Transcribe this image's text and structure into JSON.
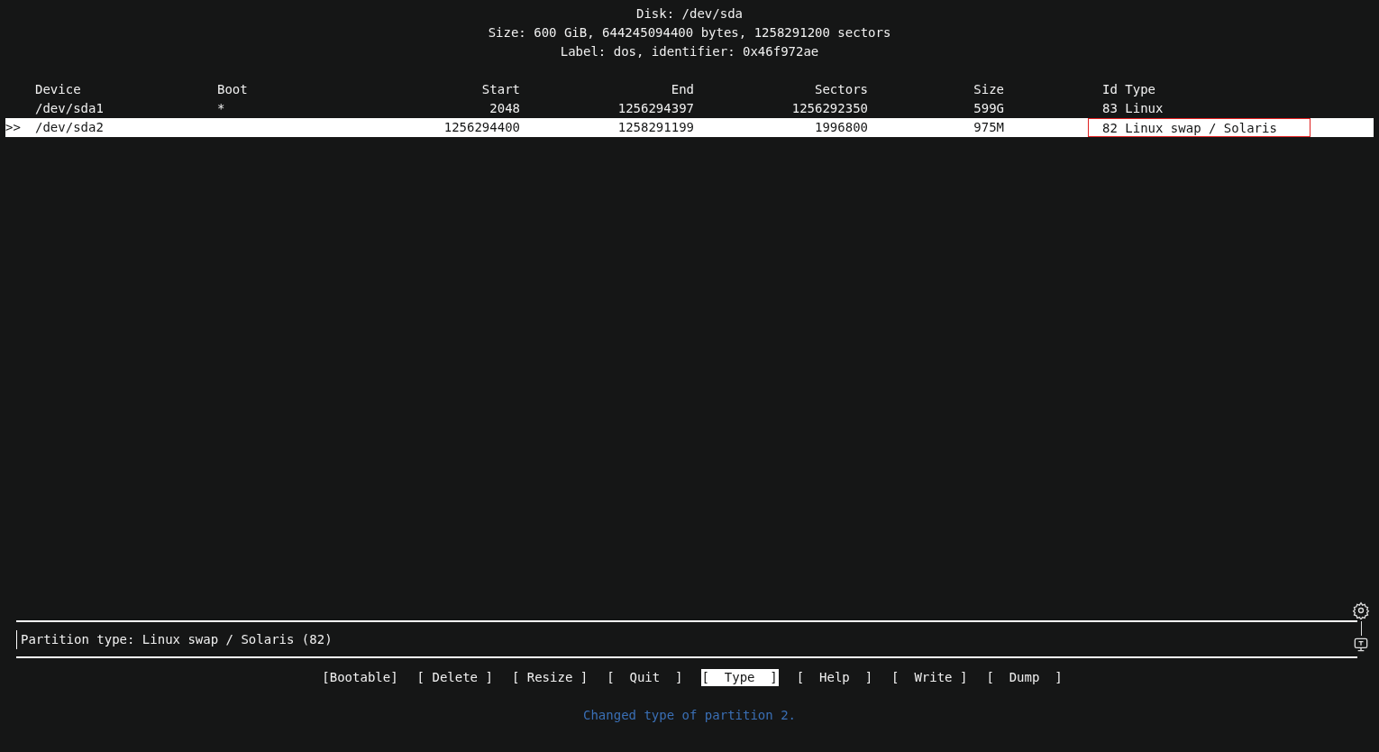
{
  "header": {
    "disk": "Disk: /dev/sda",
    "size": "Size: 600 GiB, 644245094400 bytes, 1258291200 sectors",
    "label": "Label: dos, identifier: 0x46f972ae"
  },
  "table": {
    "cursor": ">>",
    "columns": [
      "Device",
      "Boot",
      "Start",
      "End",
      "Sectors",
      "Size",
      "Id Type"
    ],
    "rows": [
      {
        "selected": false,
        "type_outlined": false,
        "cells": [
          "/dev/sda1",
          "*",
          "2048",
          "1256294397",
          "1256292350",
          "599G",
          "83 Linux"
        ]
      },
      {
        "selected": true,
        "type_outlined": true,
        "cells": [
          "/dev/sda2",
          "",
          "1256294400",
          "1258291199",
          "1996800",
          "975M",
          "82 Linux swap / Solaris"
        ]
      }
    ]
  },
  "info_box": {
    "text": "Partition type: Linux swap / Solaris (82)"
  },
  "actions": [
    {
      "label": "[Bootable]",
      "selected": false
    },
    {
      "label": "[ Delete ]",
      "selected": false
    },
    {
      "label": "[ Resize ]",
      "selected": false
    },
    {
      "label": "[  Quit  ]",
      "selected": false
    },
    {
      "label": "[  Type  ]",
      "selected": true
    },
    {
      "label": "[  Help  ]",
      "selected": false
    },
    {
      "label": "[  Write ]",
      "selected": false
    },
    {
      "label": "[  Dump  ]",
      "selected": false
    }
  ],
  "status": "Changed type of partition 2."
}
